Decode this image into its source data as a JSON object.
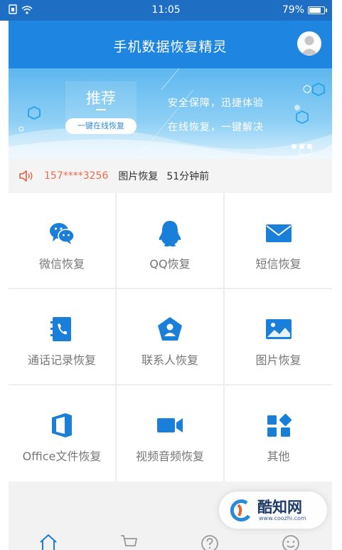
{
  "status_bar": {
    "time": "11:05",
    "battery": "79%",
    "battery_level": 0.79
  },
  "header": {
    "title": "手机数据恢复精灵"
  },
  "banner": {
    "recommend": "推荐",
    "oneclick": "一键在线恢复",
    "slogan1": "安全保障，迅捷体验",
    "slogan2": "在线恢复，一键解决"
  },
  "notice": {
    "phone": "157****3256",
    "type": "图片恢复",
    "time": "51分钟前"
  },
  "features": [
    {
      "label": "微信恢复",
      "icon": "wechat-icon"
    },
    {
      "label": "QQ恢复",
      "icon": "qq-icon"
    },
    {
      "label": "短信恢复",
      "icon": "sms-icon"
    },
    {
      "label": "通话记录恢复",
      "icon": "call-log-icon"
    },
    {
      "label": "联系人恢复",
      "icon": "contacts-icon"
    },
    {
      "label": "图片恢复",
      "icon": "image-icon"
    },
    {
      "label": "Office文件恢复",
      "icon": "office-icon"
    },
    {
      "label": "视频音频恢复",
      "icon": "video-icon"
    },
    {
      "label": "其他",
      "icon": "other-icon"
    }
  ],
  "tabbar": [
    "home-icon",
    "cart-icon",
    "help-icon",
    "smile-icon"
  ],
  "watermark": {
    "name": "酷知网",
    "url": "www.coozhi.com"
  },
  "colors": {
    "primary": "#1e86e0",
    "icon_blue": "#1a7fd8",
    "notice_red": "#e86c4f"
  }
}
